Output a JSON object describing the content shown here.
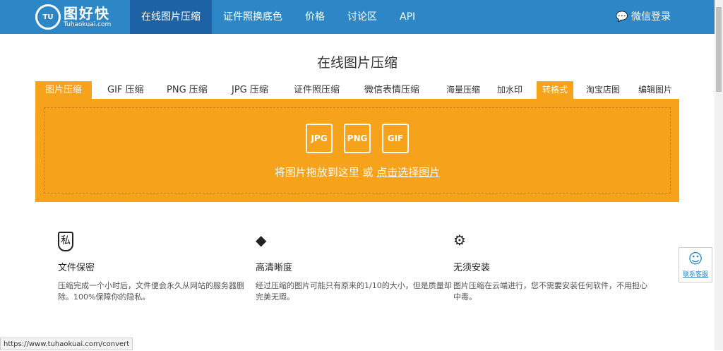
{
  "header": {
    "logo_cn": "图好快",
    "logo_en": "Tuhaokuai.com",
    "logo_mark": "TU",
    "nav": [
      "在线图片压缩",
      "证件照换底色",
      "价格",
      "讨论区",
      "API"
    ],
    "login": "微信登录"
  },
  "page_title": "在线图片压缩",
  "tabs": [
    "图片压缩",
    "GIF 压缩",
    "PNG 压缩",
    "JPG 压缩",
    "证件照压缩",
    "微信表情压缩",
    "海量压缩",
    "加水印",
    "转格式",
    "淘宝店图",
    "编辑图片"
  ],
  "upload": {
    "formats": [
      "JPG",
      "PNG",
      "GIF"
    ],
    "drop_text": "将图片拖放到这里 或 ",
    "select_link": "点击选择图片"
  },
  "features": [
    {
      "icon": "私",
      "title": "文件保密",
      "desc": "压缩完成一个小时后，文件便会永久从网站的服务器删除。100%保障你的隐私。"
    },
    {
      "icon": "◆",
      "title": "高清晰度",
      "desc": "经过压缩的图片可能只有原来的1/10的大小，但是质量却完美无瑕。"
    },
    {
      "icon": "⚙",
      "title": "无须安装",
      "desc": "图片压缩在云端进行，您不需要安装任何软件，不用担心中毒。"
    }
  ],
  "customer_service": "联系客服",
  "status_url": "https://www.tuhaokuai.com/convert",
  "colors": {
    "header": "#2d87c6",
    "accent": "#f7a21b"
  }
}
